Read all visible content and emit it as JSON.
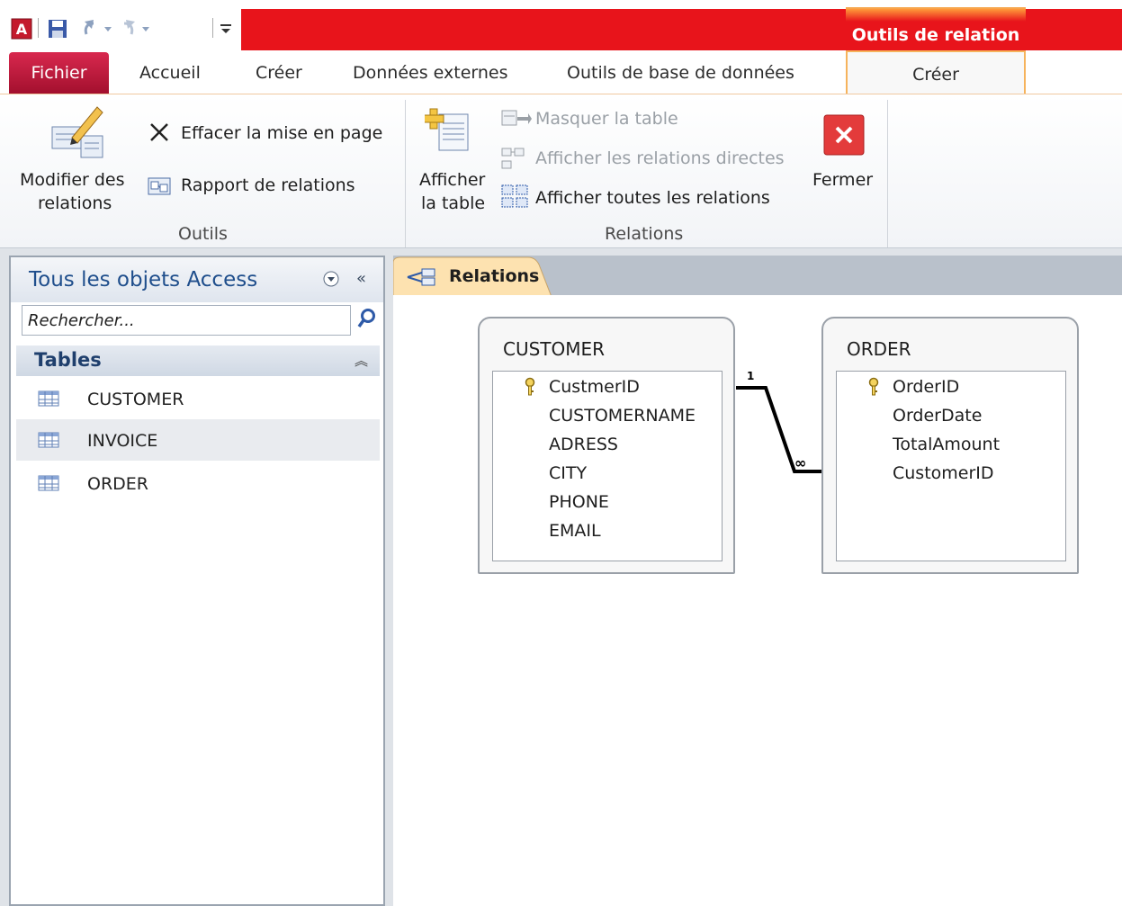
{
  "app": {
    "logo_letter": "A"
  },
  "context_tab": {
    "header": "Outils de relation",
    "tab_label": "Créer"
  },
  "tabs": [
    "Accueil",
    "Créer",
    "Données externes",
    "Outils de base de données"
  ],
  "file_tab": "Fichier",
  "ribbon": {
    "outils": {
      "label": "Outils",
      "modifier": "Modifier des",
      "modifier2": "relations",
      "effacer": "Effacer la mise en page",
      "rapport": "Rapport de relations"
    },
    "relations": {
      "label": "Relations",
      "afficher": "Afficher",
      "afficher2": "la table",
      "masquer": "Masquer la table",
      "directes": "Afficher les relations directes",
      "toutes": "Afficher toutes les relations",
      "fermer": "Fermer"
    }
  },
  "nav": {
    "title": "Tous les objets Access",
    "search_placeholder": "Rechercher...",
    "group": "Tables",
    "items": [
      "CUSTOMER",
      "INVOICE",
      "ORDER"
    ],
    "selected_index": 1
  },
  "doc_tab": "Relations",
  "tables": [
    {
      "name": "CUSTOMER",
      "fields": [
        "CustmerID",
        "CUSTOMERNAME",
        "ADRESS",
        "CITY",
        "PHONE",
        "EMAIL"
      ],
      "key_field": 0
    },
    {
      "name": "ORDER",
      "fields": [
        "OrderID",
        "OrderDate",
        "TotalAmount",
        "CustomerID"
      ],
      "key_field": 0
    }
  ],
  "relationship": {
    "one_label": "1",
    "many_label": "∞"
  },
  "colors": {
    "title_red": "#e8141b",
    "file_tab": "#b8173a",
    "context_orange": "#f7a54c",
    "nav_title": "#1f4e8c"
  }
}
